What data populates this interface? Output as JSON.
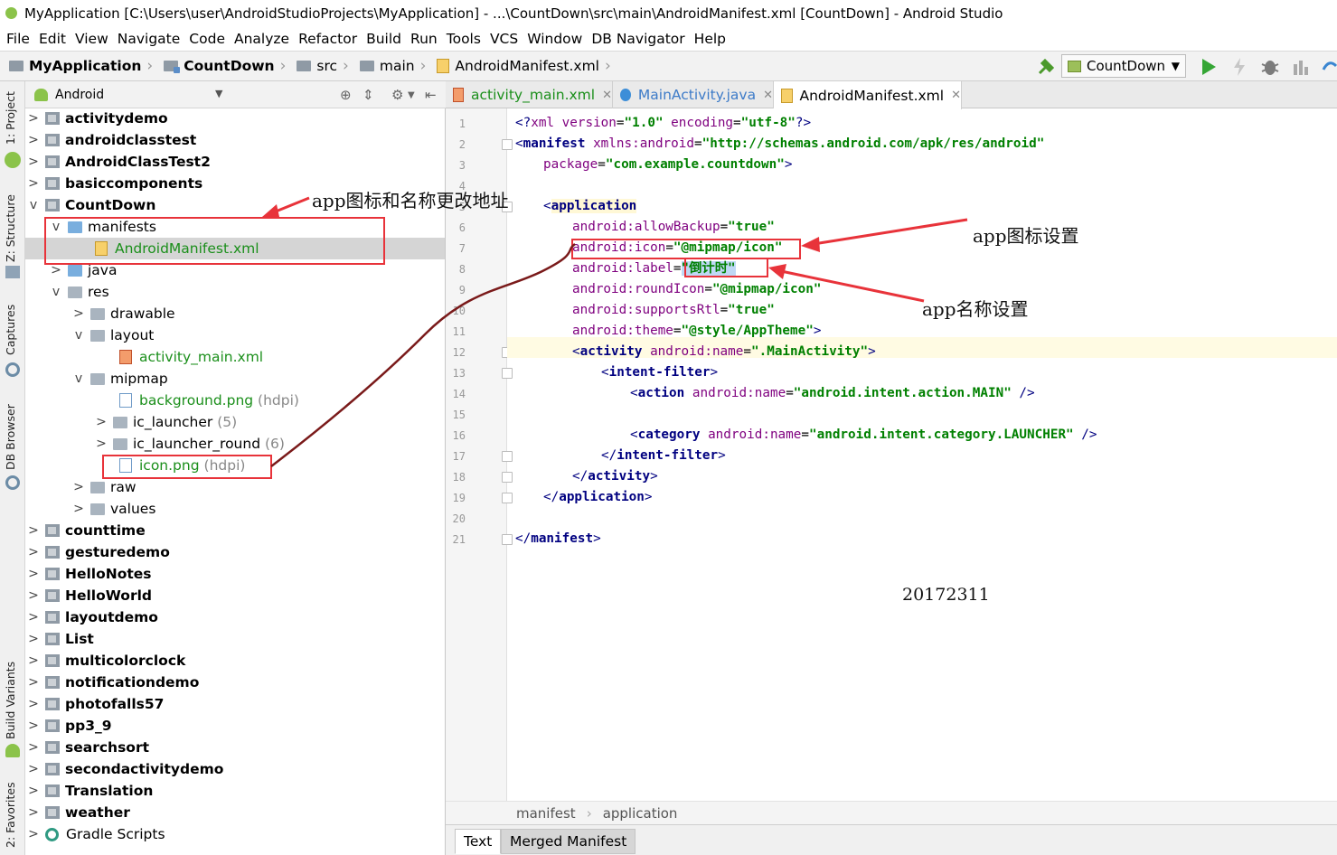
{
  "window": {
    "title": "MyApplication [C:\\Users\\user\\AndroidStudioProjects\\MyApplication] - ...\\CountDown\\src\\main\\AndroidManifest.xml [CountDown] - Android Studio"
  },
  "menu": [
    "File",
    "Edit",
    "View",
    "Navigate",
    "Code",
    "Analyze",
    "Refactor",
    "Build",
    "Run",
    "Tools",
    "VCS",
    "Window",
    "DB Navigator",
    "Help"
  ],
  "breadcrumb": [
    "MyApplication",
    "CountDown",
    "src",
    "main",
    "AndroidManifest.xml"
  ],
  "run_config": "CountDown",
  "side_tabs": [
    "1: Project",
    "Z: Structure",
    "Captures",
    "DB Browser",
    "Build Variants",
    "2: Favorites"
  ],
  "project_panel": {
    "view_mode": "Android",
    "tree": [
      {
        "label": "activitydemo"
      },
      {
        "label": "androidclasstest"
      },
      {
        "label": "AndroidClassTest2"
      },
      {
        "label": "basiccomponents"
      },
      {
        "label": "CountDown"
      },
      {
        "label": "manifests"
      },
      {
        "label": "AndroidManifest.xml"
      },
      {
        "label": "java"
      },
      {
        "label": "res"
      },
      {
        "label": "drawable"
      },
      {
        "label": "layout"
      },
      {
        "label": "activity_main.xml"
      },
      {
        "label": "mipmap"
      },
      {
        "label": "background.png",
        "note": "(hdpi)"
      },
      {
        "label": "ic_launcher",
        "note": "(5)"
      },
      {
        "label": "ic_launcher_round",
        "note": "(6)"
      },
      {
        "label": "icon.png",
        "note": "(hdpi)"
      },
      {
        "label": "raw"
      },
      {
        "label": "values"
      },
      {
        "label": "counttime"
      },
      {
        "label": "gesturedemo"
      },
      {
        "label": "HelloNotes"
      },
      {
        "label": "HelloWorld"
      },
      {
        "label": "layoutdemo"
      },
      {
        "label": "List"
      },
      {
        "label": "multicolorclock"
      },
      {
        "label": "notificationdemo"
      },
      {
        "label": "photofalls57"
      },
      {
        "label": "pp3_9"
      },
      {
        "label": "searchsort"
      },
      {
        "label": "secondactivitydemo"
      },
      {
        "label": "Translation"
      },
      {
        "label": "weather"
      },
      {
        "label": "Gradle Scripts"
      }
    ]
  },
  "editor": {
    "tabs": [
      "activity_main.xml",
      "MainActivity.java",
      "AndroidManifest.xml"
    ],
    "line_numbers": [
      "1",
      "2",
      "3",
      "4",
      "5",
      "6",
      "7",
      "8",
      "9",
      "10",
      "11",
      "12",
      "13",
      "14",
      "15",
      "16",
      "17",
      "18",
      "19",
      "20",
      "21"
    ],
    "code": {
      "l1_a": "<?",
      "l1_b": "xml version",
      "l1_c": "=",
      "l1_d": "\"1.0\"",
      "l1_e": " encoding",
      "l1_f": "=",
      "l1_g": "\"utf-8\"",
      "l1_h": "?>",
      "l2_a": "<",
      "l2_b": "manifest ",
      "l2_c": "xmlns:android",
      "l2_d": "=",
      "l2_e": "\"http://schemas.android.com/apk/res/android\"",
      "l3_a": "package",
      "l3_b": "=",
      "l3_c": "\"com.example.countdown\"",
      "l3_d": ">",
      "l5_a": "<",
      "l5_b": "application",
      "l6_a": "android:",
      "l6_b": "allowBackup",
      "l6_c": "=",
      "l6_d": "\"true\"",
      "l7_a": "android:",
      "l7_b": "icon",
      "l7_c": "=",
      "l7_d": "\"@mipmap/icon\"",
      "l8_a": "android:",
      "l8_b": "label",
      "l8_c": "=",
      "l8_d": "\"倒计时\"",
      "l9_a": "android:",
      "l9_b": "roundIcon",
      "l9_c": "=",
      "l9_d": "\"@mipmap/icon\"",
      "l10_a": "android:",
      "l10_b": "supportsRtl",
      "l10_c": "=",
      "l10_d": "\"true\"",
      "l11_a": "android:",
      "l11_b": "theme",
      "l11_c": "=",
      "l11_d": "\"@style/AppTheme\"",
      "l11_e": ">",
      "l12_a": "<",
      "l12_b": "activity ",
      "l12_c": "android:",
      "l12_d": "name",
      "l12_e": "=",
      "l12_f": "\".MainActivity\"",
      "l12_g": ">",
      "l13_a": "<",
      "l13_b": "intent-filter",
      "l13_c": ">",
      "l14_a": "<",
      "l14_b": "action ",
      "l14_c": "android:",
      "l14_d": "name",
      "l14_e": "=",
      "l14_f": "\"android.intent.action.MAIN\"",
      "l14_g": " />",
      "l16_a": "<",
      "l16_b": "category ",
      "l16_c": "android:",
      "l16_d": "name",
      "l16_e": "=",
      "l16_f": "\"android.intent.category.LAUNCHER\"",
      "l16_g": " />",
      "l17_a": "</",
      "l17_b": "intent-filter",
      "l17_c": ">",
      "l18_a": "</",
      "l18_b": "activity",
      "l18_c": ">",
      "l19_a": "</",
      "l19_b": "application",
      "l19_c": ">",
      "l21_a": "</",
      "l21_b": "manifest",
      "l21_c": ">"
    },
    "breadcrumb": [
      "manifest",
      "application"
    ],
    "bottom_tabs": [
      "Text",
      "Merged Manifest"
    ]
  },
  "annotations": {
    "path_note": "app图标和名称更改地址",
    "icon_note": "app图标设置",
    "name_note": "app名称设置",
    "student_id": "20172311"
  },
  "colors": {
    "annotation_red": "#e8333a",
    "connector": "#7a1a1a",
    "xml_tag": "#000080",
    "xml_attr": "#7f007f",
    "xml_value": "#008000"
  }
}
